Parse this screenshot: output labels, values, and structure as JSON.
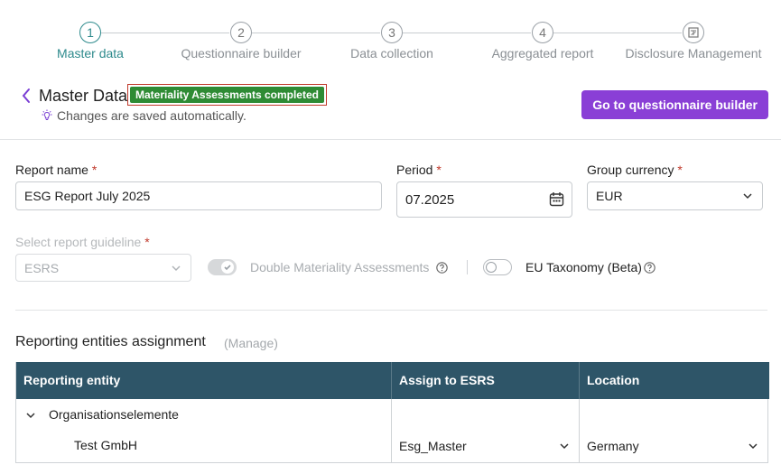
{
  "stepper": {
    "steps": [
      {
        "number": "1",
        "label": "Master data"
      },
      {
        "number": "2",
        "label": "Questionnaire builder"
      },
      {
        "number": "3",
        "label": "Data collection"
      },
      {
        "number": "4",
        "label": "Aggregated report"
      },
      {
        "number": "",
        "label": "Disclosure Management"
      }
    ],
    "active_index": 0
  },
  "header": {
    "title": "Master Data",
    "badge": "Materiality Assessments completed",
    "autosave_text": "Changes are saved automatically.",
    "primary_button": "Go to questionnaire builder"
  },
  "form": {
    "report_name": {
      "label": "Report name",
      "value": "ESG Report July 2025"
    },
    "period": {
      "label": "Period",
      "value": "07.2025"
    },
    "group_currency": {
      "label": "Group currency",
      "value": "EUR"
    },
    "report_guideline": {
      "label": "Select report guideline",
      "value": "ESRS"
    },
    "double_materiality": {
      "label": "Double Materiality Assessments",
      "enabled": true,
      "disabled": true
    },
    "eu_taxonomy": {
      "label": "EU Taxonomy (Beta)",
      "enabled": false
    },
    "required_marker": "*"
  },
  "entities": {
    "title": "Reporting entities assignment",
    "manage_label": "(Manage)",
    "columns": [
      "Reporting entity",
      "Assign to ESRS",
      "Location"
    ],
    "group_row": {
      "label": "Organisationselemente"
    },
    "rows": [
      {
        "entity": "Test GmbH",
        "assign": "Esg_Master",
        "location": "Germany"
      }
    ]
  },
  "colors": {
    "accent": "#8a3fd6",
    "active_step": "#2d8a8c",
    "badge_bg": "#2e8b34",
    "table_header": "#2e5568",
    "required": "#c0392b"
  }
}
